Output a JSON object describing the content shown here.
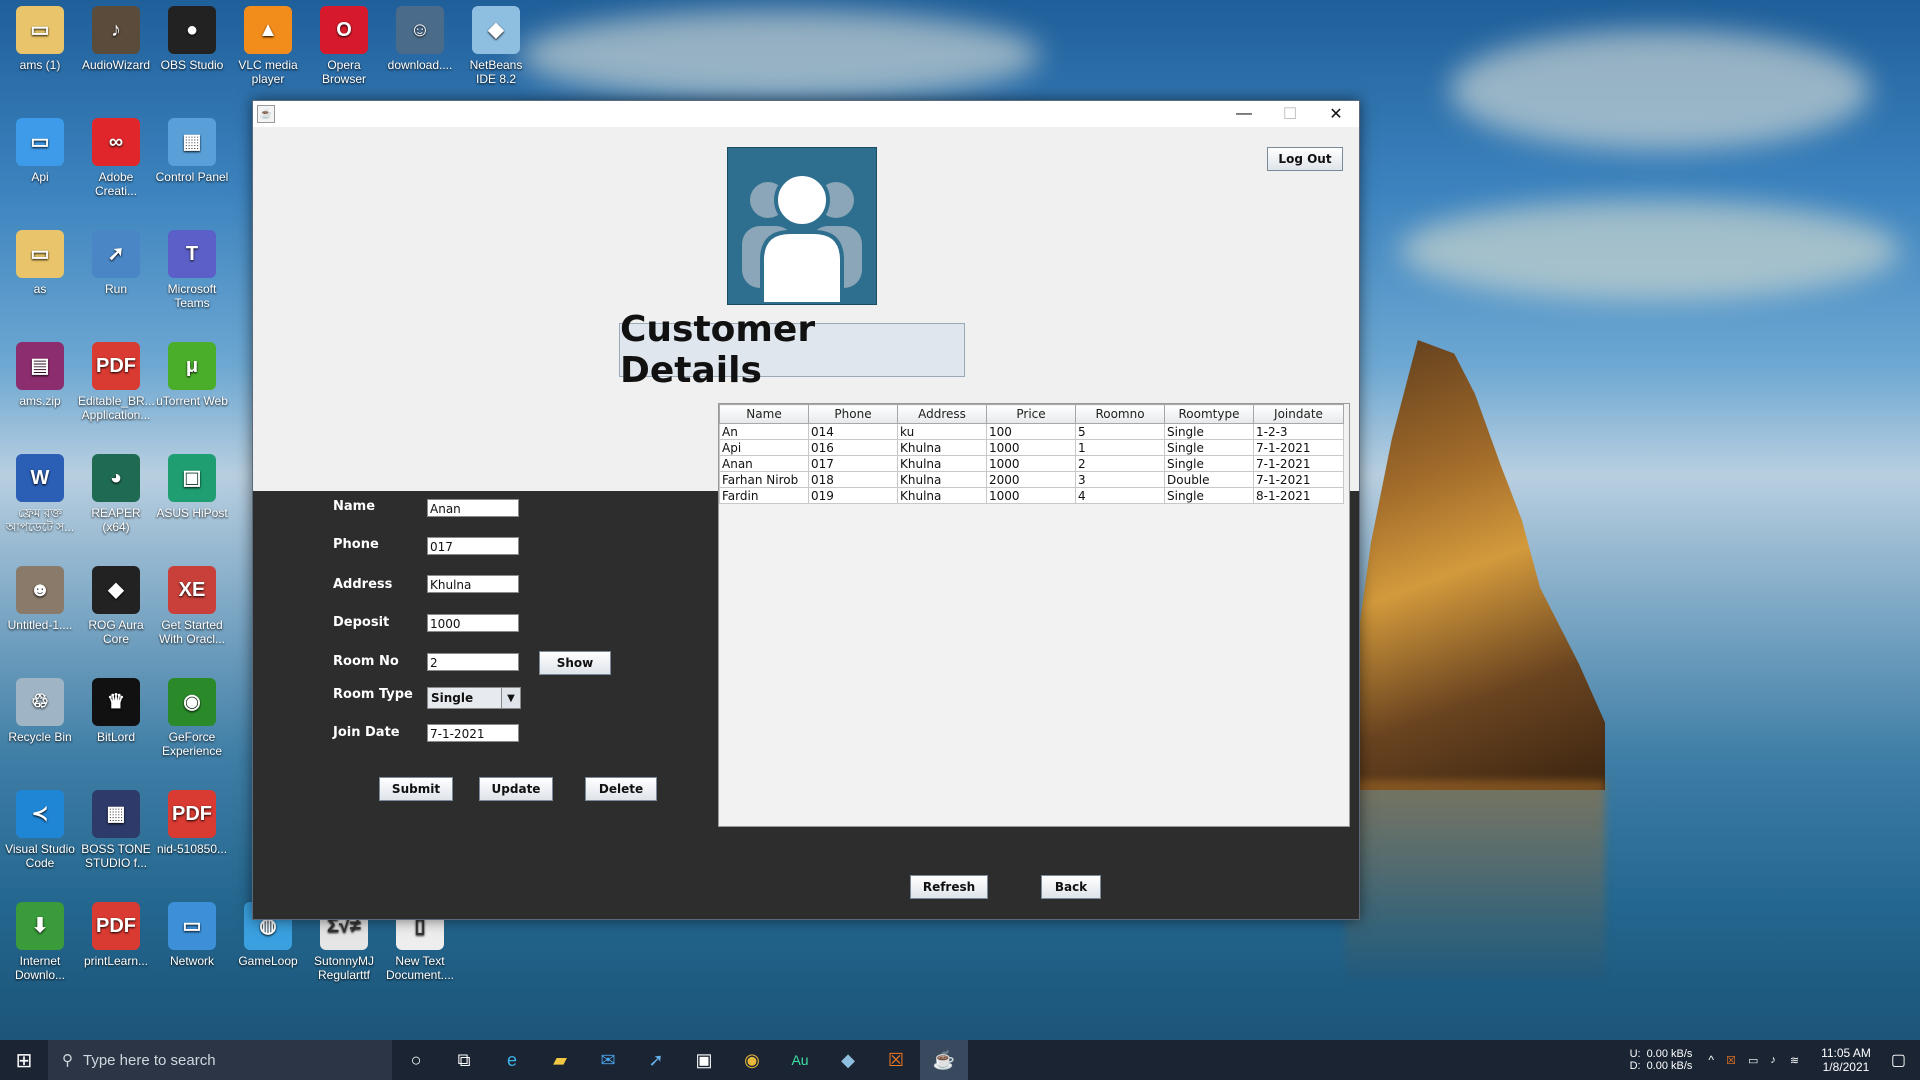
{
  "desktop": {
    "icons": [
      {
        "label": "ams (1)",
        "glyph": "▭",
        "color": "#e9c46a"
      },
      {
        "label": "AudioWizard",
        "glyph": "♪",
        "color": "#5a4b3a"
      },
      {
        "label": "OBS Studio",
        "glyph": "●",
        "color": "#222222"
      },
      {
        "label": "VLC media player",
        "glyph": "▲",
        "color": "#f28c1b"
      },
      {
        "label": "Opera Browser",
        "glyph": "O",
        "color": "#d61a2b"
      },
      {
        "label": "download....",
        "glyph": "☺",
        "color": "#4a6b8a"
      },
      {
        "label": "NetBeans IDE 8.2",
        "glyph": "◆",
        "color": "#8fbfe0"
      },
      {
        "label": "Api",
        "glyph": "▭",
        "color": "#3d9be9"
      },
      {
        "label": "Adobe Creati...",
        "glyph": "∞",
        "color": "#e0262b"
      },
      {
        "label": "Control Panel",
        "glyph": "▦",
        "color": "#5aa0d8"
      },
      {
        "label": "as",
        "glyph": "▭",
        "color": "#e9c46a"
      },
      {
        "label": "Run",
        "glyph": "➚",
        "color": "#4a86c5"
      },
      {
        "label": "Microsoft Teams",
        "glyph": "T",
        "color": "#5b5fc7"
      },
      {
        "label": "ams.zip",
        "glyph": "▤",
        "color": "#8b2d6e"
      },
      {
        "label": "Editable_BR... Application...",
        "glyph": "PDF",
        "color": "#d93a32"
      },
      {
        "label": "uTorrent Web",
        "glyph": "μ",
        "color": "#4aae2b"
      },
      {
        "label": "ফ্রেম রক্ত আপডেটে স...",
        "glyph": "W",
        "color": "#2b5eb5"
      },
      {
        "label": "REAPER (x64)",
        "glyph": "◕",
        "color": "#1f6a52"
      },
      {
        "label": "ASUS HiPost",
        "glyph": "▣",
        "color": "#1f9e72"
      },
      {
        "label": "Untitled-1....",
        "glyph": "☻",
        "color": "#8a7a6a"
      },
      {
        "label": "ROG Aura Core",
        "glyph": "◆",
        "color": "#222222"
      },
      {
        "label": "Get Started With Oracl...",
        "glyph": "XE",
        "color": "#c9403a"
      },
      {
        "label": "Recycle Bin",
        "glyph": "♲",
        "color": "#9fb5c5"
      },
      {
        "label": "BitLord",
        "glyph": "♛",
        "color": "#111111"
      },
      {
        "label": "GeForce Experience",
        "glyph": "◉",
        "color": "#2a8a2a"
      },
      {
        "label": "Visual Studio Code",
        "glyph": "≺",
        "color": "#1f86d6"
      },
      {
        "label": "BOSS TONE STUDIO f...",
        "glyph": "▦",
        "color": "#2d3a6a"
      },
      {
        "label": "nid-510850...",
        "glyph": "PDF",
        "color": "#d93a32"
      },
      {
        "label": "Internet Downlo...",
        "glyph": "⬇",
        "color": "#3a9b3a"
      },
      {
        "label": "printLearn...",
        "glyph": "PDF",
        "color": "#d93a32"
      },
      {
        "label": "Network",
        "glyph": "▭",
        "color": "#3d8fd8"
      },
      {
        "label": "GameLoop",
        "glyph": "◍",
        "color": "#3aa0e0"
      },
      {
        "label": "SutonnyMJ Regularttf",
        "glyph": "Σ√≠",
        "color": "#e6e6e6"
      },
      {
        "label": "New Text Document....",
        "glyph": "▯",
        "color": "#eeeeee"
      }
    ]
  },
  "window": {
    "logout_label": "Log Out",
    "heading": "Customer Details",
    "form": {
      "name_label": "Name",
      "name_value": "Anan",
      "phone_label": "Phone",
      "phone_value": "017",
      "address_label": "Address",
      "address_value": "Khulna",
      "deposit_label": "Deposit",
      "deposit_value": "1000",
      "roomno_label": "Room No",
      "roomno_value": "2",
      "show_label": "Show",
      "roomtype_label": "Room Type",
      "roomtype_value": "Single",
      "joindate_label": "Join Date",
      "joindate_value": "7-1-2021",
      "submit_label": "Submit",
      "update_label": "Update",
      "delete_label": "Delete"
    },
    "table": {
      "columns": [
        "Name",
        "Phone",
        "Address",
        "Price",
        "Roomno",
        "Roomtype",
        "Joindate"
      ],
      "rows": [
        [
          "An",
          "014",
          "ku",
          "100",
          "5",
          "Single",
          "1-2-3"
        ],
        [
          "Api",
          "016",
          "Khulna",
          "1000",
          "1",
          "Single",
          "7-1-2021"
        ],
        [
          "Anan",
          "017",
          "Khulna",
          "1000",
          "2",
          "Single",
          "7-1-2021"
        ],
        [
          "Farhan Nirob",
          "018",
          "Khulna",
          "2000",
          "3",
          "Double",
          "7-1-2021"
        ],
        [
          "Fardin",
          "019",
          "Khulna",
          "1000",
          "4",
          "Single",
          "8-1-2021"
        ]
      ]
    },
    "refresh_label": "Refresh",
    "back_label": "Back"
  },
  "taskbar": {
    "search_placeholder": "Type here to search",
    "net_up_label": "U:",
    "net_down_label": "D:",
    "net_up": "0.00 kB/s",
    "net_down": "0.00 kB/s",
    "time": "11:05 AM",
    "date": "1/8/2021"
  }
}
